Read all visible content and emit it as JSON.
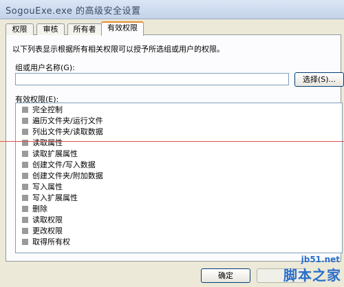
{
  "window": {
    "title": "SogouExe.exe 的高级安全设置"
  },
  "tabs": [
    {
      "label": "权限"
    },
    {
      "label": "审核"
    },
    {
      "label": "所有者"
    },
    {
      "label": "有效权限"
    }
  ],
  "panel": {
    "description": "以下列表显示根据所有相关权限可以授予所选组或用户的权限。",
    "group_label": "组或用户名称(G):",
    "group_value": "",
    "select_button": "选择(S)...",
    "permissions_label": "有效权限(E):",
    "permissions": [
      {
        "label": "完全控制",
        "checked": false
      },
      {
        "label": "遍历文件夹/运行文件",
        "checked": false
      },
      {
        "label": "列出文件夹/读取数据",
        "checked": false
      },
      {
        "label": "读取属性",
        "checked": false
      },
      {
        "label": "读取扩展属性",
        "checked": false
      },
      {
        "label": "创建文件/写入数据",
        "checked": false
      },
      {
        "label": "创建文件夹/附加数据",
        "checked": false
      },
      {
        "label": "写入属性",
        "checked": false
      },
      {
        "label": "写入扩展属性",
        "checked": false
      },
      {
        "label": "删除",
        "checked": false
      },
      {
        "label": "读取权限",
        "checked": false
      },
      {
        "label": "更改权限",
        "checked": false
      },
      {
        "label": "取得所有权",
        "checked": false
      }
    ]
  },
  "footer": {
    "ok_button": "确定"
  },
  "watermark": {
    "site": "jb51.net",
    "name": "脚本之家"
  },
  "colors": {
    "accent_tab": "#e68b2c",
    "redline": "#e0504a",
    "watermark": "#2a6fc9"
  }
}
